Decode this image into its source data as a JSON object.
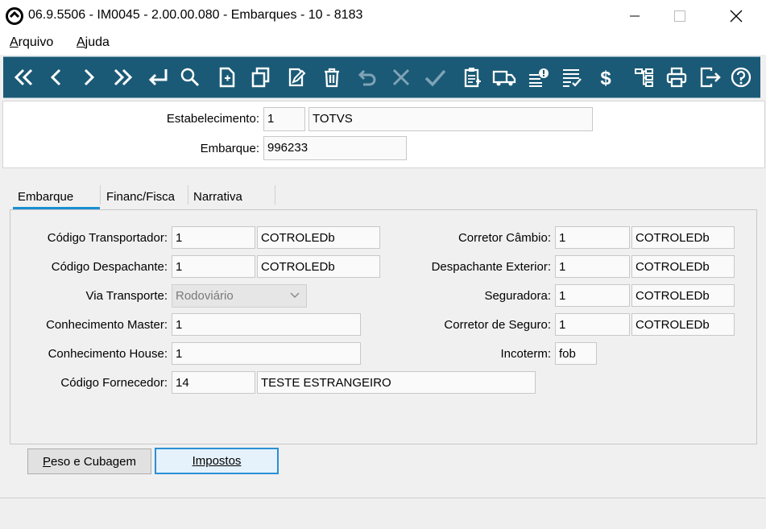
{
  "window": {
    "title": "06.9.5506 - IM0045 - 2.00.00.080 - Embarques - 10 - 8183",
    "minimize_icon": "minimize-icon",
    "maximize_icon": "maximize-icon",
    "close_icon": "close-icon"
  },
  "menu": {
    "arquivo_first": "A",
    "arquivo_rest": "rquivo",
    "ajuda_first": "A",
    "ajuda_rest": "juda"
  },
  "toolbar": {
    "background": "#1b5a76",
    "icons": [
      "first-record-icon",
      "previous-record-icon",
      "next-record-icon",
      "last-record-icon",
      "goto-icon",
      "search-icon",
      "new-document-icon",
      "copy-icon",
      "edit-icon",
      "delete-icon",
      "undo-icon",
      "cancel-icon",
      "confirm-icon",
      "clipboard-icon",
      "truck-icon",
      "list-alert-icon",
      "list-check-icon",
      "dollar-icon",
      "tree-icon",
      "print-icon",
      "exit-icon",
      "help-icon"
    ]
  },
  "header": {
    "estabelecimento_label": "Estabelecimento:",
    "estabelecimento_code": "1",
    "estabelecimento_name": "TOTVS",
    "embarque_label": "Embarque:",
    "embarque_value": "996233"
  },
  "tabs": {
    "embarque": "Embarque",
    "financ": "Financ/Fisca",
    "narrativa": "Narrativa",
    "active_color": "#1a8fd3"
  },
  "form": {
    "cod_transportador_label": "Código Transportador:",
    "cod_transportador_code": "1",
    "cod_transportador_name": "COTROLEDb",
    "cod_despachante_label": "Código Despachante:",
    "cod_despachante_code": "1",
    "cod_despachante_name": "COTROLEDb",
    "via_transporte_label": "Via Transporte:",
    "via_transporte_value": "Rodoviário",
    "conhecimento_master_label": "Conhecimento Master:",
    "conhecimento_master_value": "1",
    "conhecimento_house_label": "Conhecimento House:",
    "conhecimento_house_value": "1",
    "cod_fornecedor_label": "Código Fornecedor:",
    "cod_fornecedor_code": "14",
    "cod_fornecedor_name": "TESTE ESTRANGEIRO",
    "corretor_cambio_label": "Corretor Câmbio:",
    "corretor_cambio_code": "1",
    "corretor_cambio_name": "COTROLEDb",
    "despachante_exterior_label": "Despachante Exterior:",
    "despachante_exterior_code": "1",
    "despachante_exterior_name": "COTROLEDb",
    "seguradora_label": "Seguradora:",
    "seguradora_code": "1",
    "seguradora_name": "COTROLEDb",
    "corretor_seguro_label": "Corretor de Seguro:",
    "corretor_seguro_code": "1",
    "corretor_seguro_name": "COTROLEDb",
    "incoterm_label": "Incoterm:",
    "incoterm_value": "fob"
  },
  "buttons": {
    "peso_first": "P",
    "peso_rest": "eso e Cubagem",
    "impostos_first": "I",
    "impostos_rest": "mpostos"
  }
}
